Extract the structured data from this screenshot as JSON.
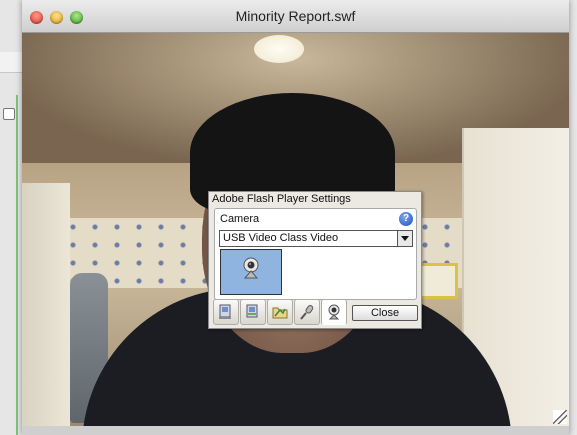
{
  "window": {
    "title": "Minority Report.swf"
  },
  "flash_settings": {
    "title": "Adobe Flash Player Settings",
    "section_label": "Camera",
    "help_glyph": "?",
    "camera_select": {
      "selected": "USB Video Class Video"
    },
    "tabs": [
      {
        "icon": "privacy-icon",
        "active": false
      },
      {
        "icon": "local-storage-icon",
        "active": false
      },
      {
        "icon": "folder-icon",
        "active": false
      },
      {
        "icon": "microphone-icon",
        "active": false
      },
      {
        "icon": "webcam-icon",
        "active": true
      }
    ],
    "close_label": "Close"
  }
}
